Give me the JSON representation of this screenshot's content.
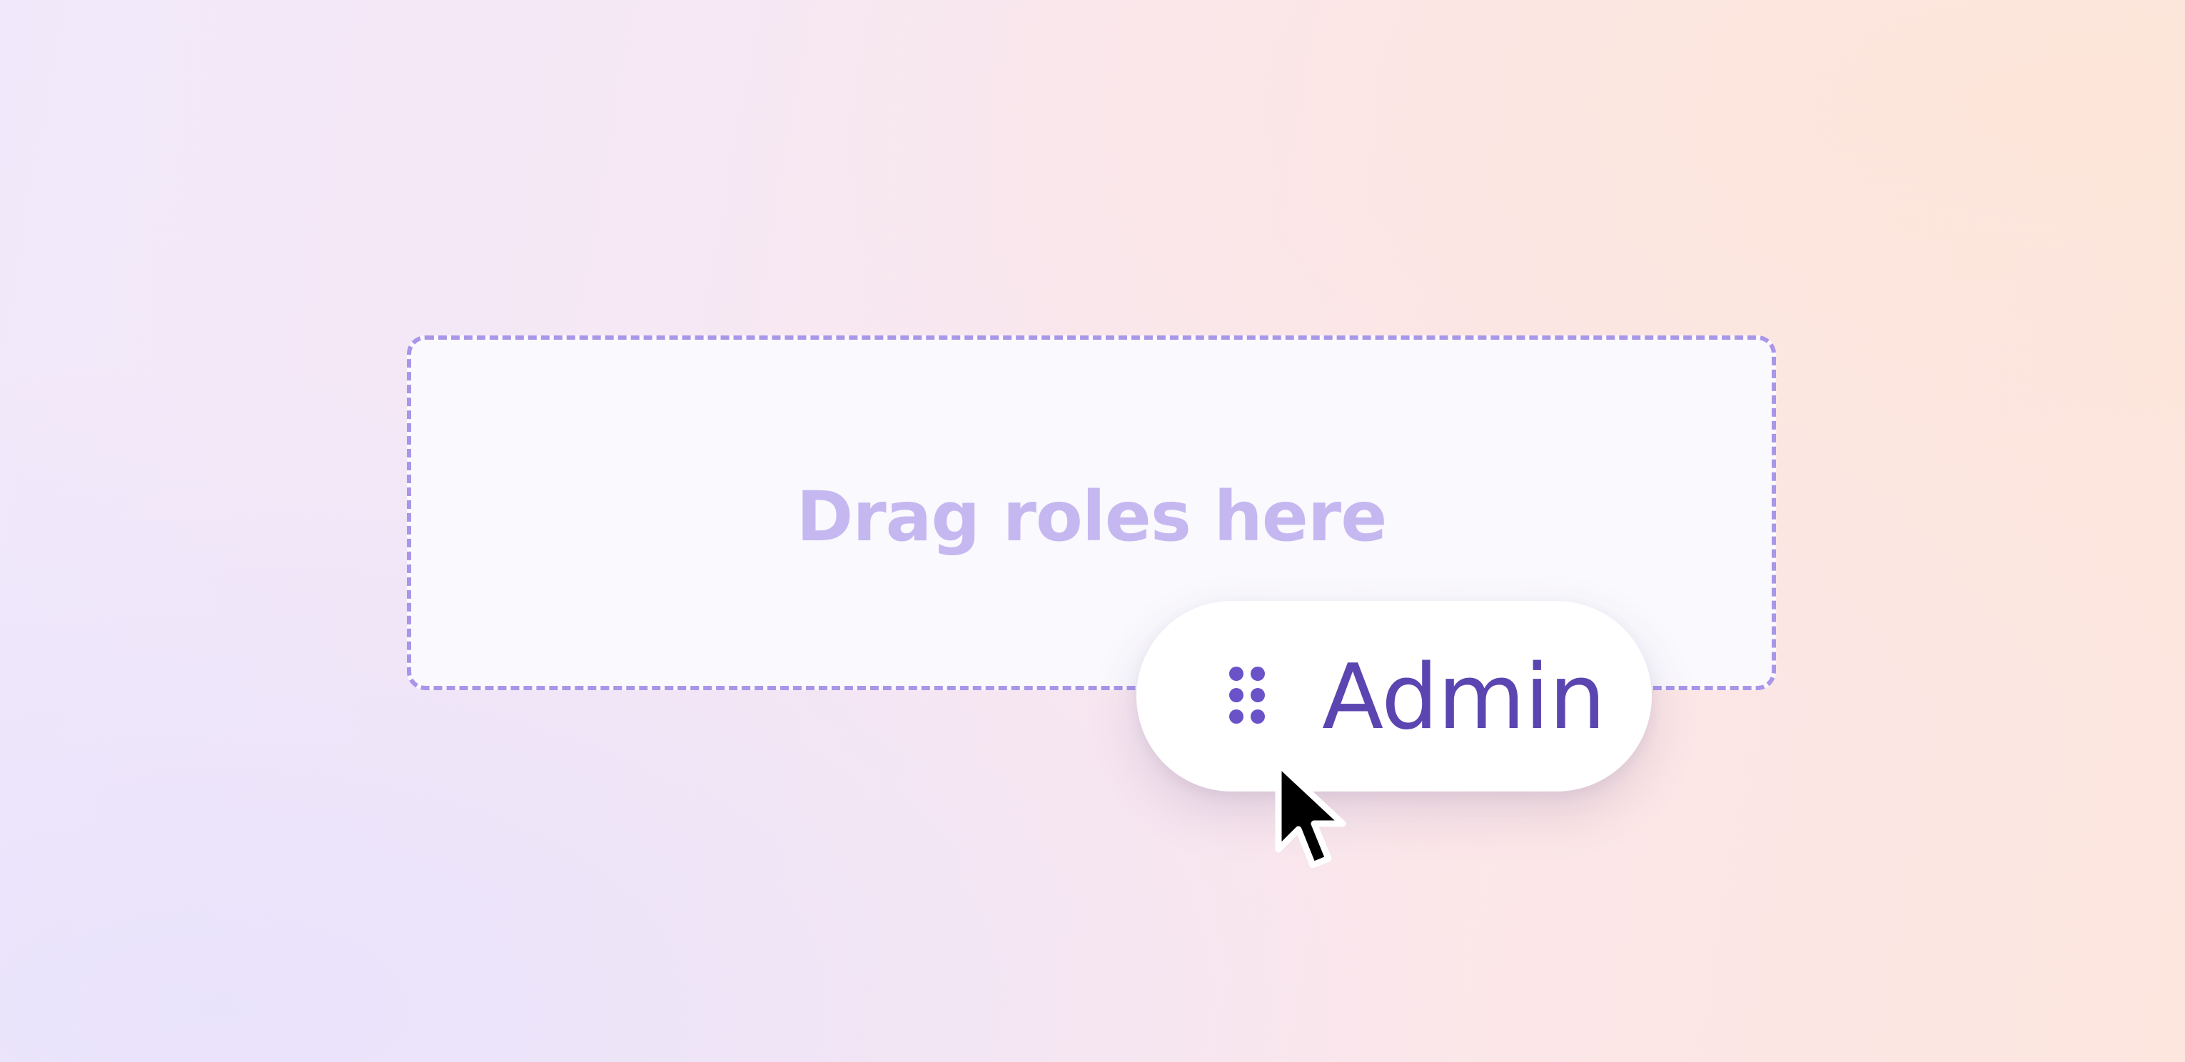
{
  "dropzone": {
    "label": "Drag roles here",
    "border_color": "#a996e8",
    "text_color": "#c5b8f1"
  },
  "dragged_item": {
    "label": "Admin",
    "handle_icon": "drag-handle-icon",
    "text_color": "#5b45b0",
    "handle_color": "#6a52c8"
  },
  "pointer": {
    "icon": "cursor-arrow-icon"
  }
}
